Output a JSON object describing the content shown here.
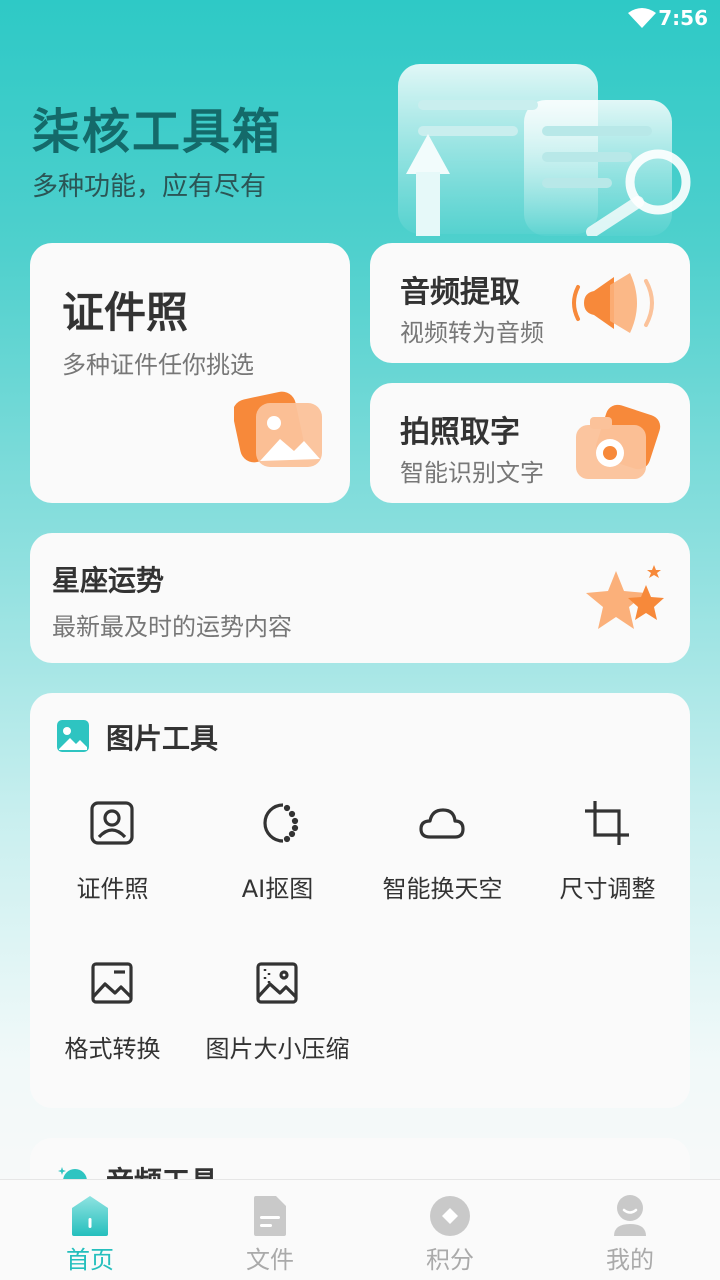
{
  "status_bar": {
    "time": "7:56"
  },
  "header": {
    "title": "柒核工具箱",
    "subtitle": "多种功能，应有尽有"
  },
  "feature_cards": {
    "id_photo": {
      "title": "证件照",
      "subtitle": "多种证件任你挑选",
      "icon": "photo-icon"
    },
    "audio_extract": {
      "title": "音频提取",
      "subtitle": "视频转为音频",
      "icon": "speaker-icon"
    },
    "photo_ocr": {
      "title": "拍照取字",
      "subtitle": "智能识别文字",
      "icon": "camera-icon"
    },
    "horoscope": {
      "title": "星座运势",
      "subtitle": "最新最及时的运势内容",
      "icon": "stars-icon"
    }
  },
  "image_tools": {
    "title": "图片工具",
    "items": [
      {
        "label": "证件照",
        "icon": "id-portrait-icon"
      },
      {
        "label": "AI抠图",
        "icon": "cutout-circle-icon"
      },
      {
        "label": "智能换天空",
        "icon": "cloud-icon"
      },
      {
        "label": "尺寸调整",
        "icon": "crop-icon"
      },
      {
        "label": "格式转换",
        "icon": "image-format-icon"
      },
      {
        "label": "图片大小压缩",
        "icon": "image-compress-icon"
      }
    ]
  },
  "audio_tools": {
    "title": "音频工具"
  },
  "tabbar": {
    "items": [
      {
        "label": "首页",
        "icon": "home-icon",
        "active": true
      },
      {
        "label": "文件",
        "icon": "file-icon",
        "active": false
      },
      {
        "label": "积分",
        "icon": "points-icon",
        "active": false
      },
      {
        "label": "我的",
        "icon": "profile-icon",
        "active": false
      }
    ]
  },
  "colors": {
    "accent": "#25bfbd",
    "orange": "#f7893a",
    "title_teal": "#146a6a"
  }
}
